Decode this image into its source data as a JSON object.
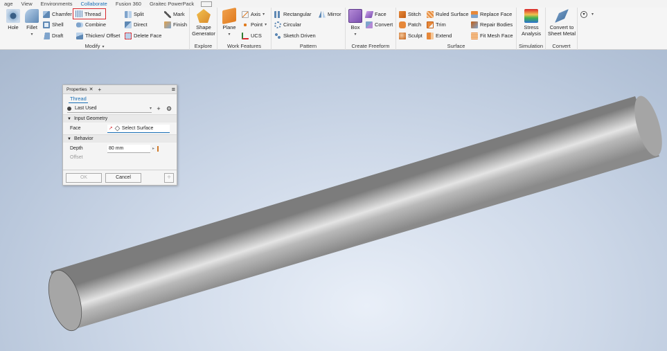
{
  "menubar": {
    "items": [
      "age",
      "View",
      "Environments",
      "Collaborate",
      "Fusion 360",
      "Graitec PowerPack"
    ],
    "active_index": 3
  },
  "ribbon": {
    "modify": {
      "label": "Modify",
      "hole": "Hole",
      "fillet": "Fillet",
      "chamfer": "Chamfer",
      "thread": "Thread",
      "shell": "Shell",
      "combine": "Combine",
      "draft": "Draft",
      "thicken": "Thicken/ Offset",
      "split": "Split",
      "mark": "Mark",
      "direct": "Direct",
      "finish": "Finish",
      "delete_face": "Delete Face"
    },
    "explore": {
      "label": "Explore",
      "shape_gen_1": "Shape",
      "shape_gen_2": "Generator"
    },
    "work": {
      "label": "Work Features",
      "plane": "Plane",
      "axis": "Axis",
      "point": "Point",
      "ucs": "UCS"
    },
    "pattern": {
      "label": "Pattern",
      "rectangular": "Rectangular",
      "mirror": "Mirror",
      "circular": "Circular",
      "sketch_driven": "Sketch Driven"
    },
    "freeform": {
      "label": "Create Freeform",
      "box": "Box",
      "face": "Face",
      "convert": "Convert"
    },
    "surface": {
      "label": "Surface",
      "stitch": "Stitch",
      "ruled": "Ruled Surface",
      "replace": "Replace Face",
      "patch": "Patch",
      "trim": "Trim",
      "repair": "Repair Bodies",
      "sculpt": "Sculpt",
      "extend": "Extend",
      "fit_mesh": "Fit Mesh Face"
    },
    "simulation": {
      "label": "Simulation",
      "stress_1": "Stress",
      "stress_2": "Analysis"
    },
    "convert": {
      "label": "Convert",
      "sheet_1": "Convert to",
      "sheet_2": "Sheet Metal"
    }
  },
  "panel": {
    "tab": "Properties",
    "feature_tab": "Thread",
    "preset": "Last Used",
    "section_input": "Input Geometry",
    "face_label": "Face",
    "face_value": "Select Surface",
    "section_behavior": "Behavior",
    "depth_label": "Depth",
    "depth_value": "80 mm",
    "offset_label": "Offset",
    "ok": "OK",
    "cancel": "Cancel"
  },
  "colors": {
    "accent": "#1a6fb5",
    "highlight": "#d9262c"
  }
}
